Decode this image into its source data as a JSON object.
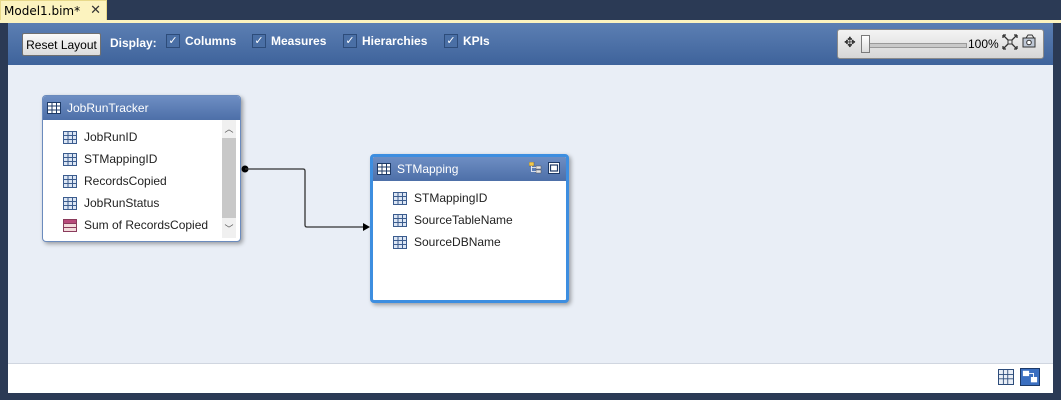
{
  "tab": {
    "title": "Model1.bim*",
    "close": "✕"
  },
  "toolbar": {
    "reset_layout": "Reset Layout",
    "display_label": "Display:",
    "checkboxes": [
      {
        "label": "Columns",
        "checked": true
      },
      {
        "label": "Measures",
        "checked": true
      },
      {
        "label": "Hierarchies",
        "checked": true
      },
      {
        "label": "KPIs",
        "checked": true
      }
    ],
    "zoom": {
      "value": "100%",
      "level": 0.0
    }
  },
  "tables": [
    {
      "name": "JobRunTracker",
      "rows": [
        {
          "label": "JobRunID",
          "icon": "column-icon"
        },
        {
          "label": "STMappingID",
          "icon": "column-icon"
        },
        {
          "label": "RecordsCopied",
          "icon": "column-icon"
        },
        {
          "label": "JobRunStatus",
          "icon": "column-icon"
        },
        {
          "label": "Sum of RecordsCopied",
          "icon": "measure-icon"
        }
      ]
    },
    {
      "name": "STMapping",
      "rows": [
        {
          "label": "STMappingID",
          "icon": "column-icon"
        },
        {
          "label": "SourceTableName",
          "icon": "column-icon"
        },
        {
          "label": "SourceDBName",
          "icon": "column-icon"
        }
      ]
    }
  ],
  "colors": {
    "accent": "#4d6fa8",
    "selection": "#3d8ee0",
    "canvas": "#e9eef6",
    "tab_active": "#fcf3bf"
  }
}
